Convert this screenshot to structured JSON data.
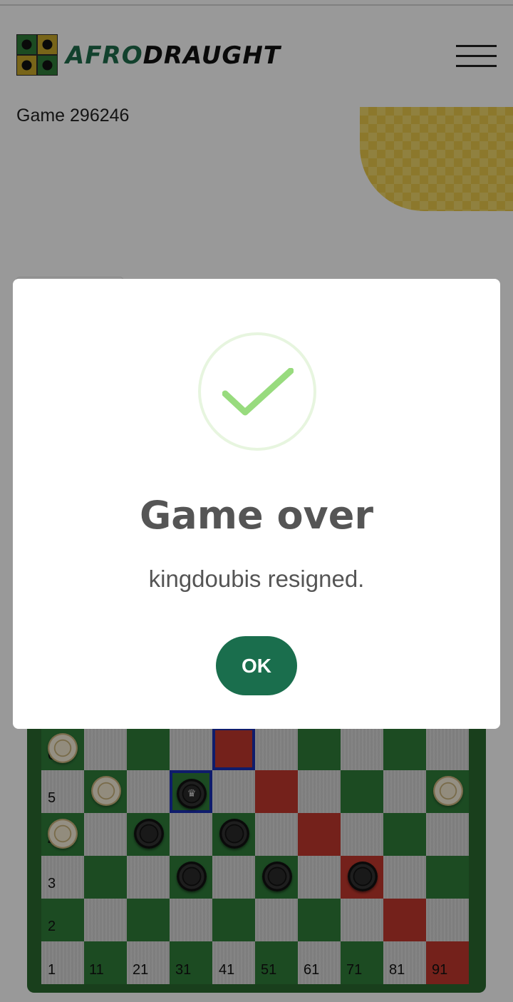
{
  "header": {
    "logo_afro": "AFRO",
    "logo_draught": "DRAUGHT"
  },
  "game": {
    "title": "Game 296246"
  },
  "board": {
    "row_labels": [
      "6",
      "5",
      "4",
      "3",
      "2",
      "1"
    ],
    "col_labels": [
      "11",
      "21",
      "31",
      "41",
      "51",
      "61",
      "71",
      "81",
      "91"
    ],
    "colors": {
      "dark": "#2f7d3a",
      "light": "#d9d9d9",
      "highlight": "#c2382d",
      "selection": "#1a2fb5"
    }
  },
  "modal": {
    "title": "Game over",
    "message": "kingdoubis resigned.",
    "ok_label": "OK",
    "icon": "success-check-icon",
    "accent": "#1a6e4d"
  }
}
